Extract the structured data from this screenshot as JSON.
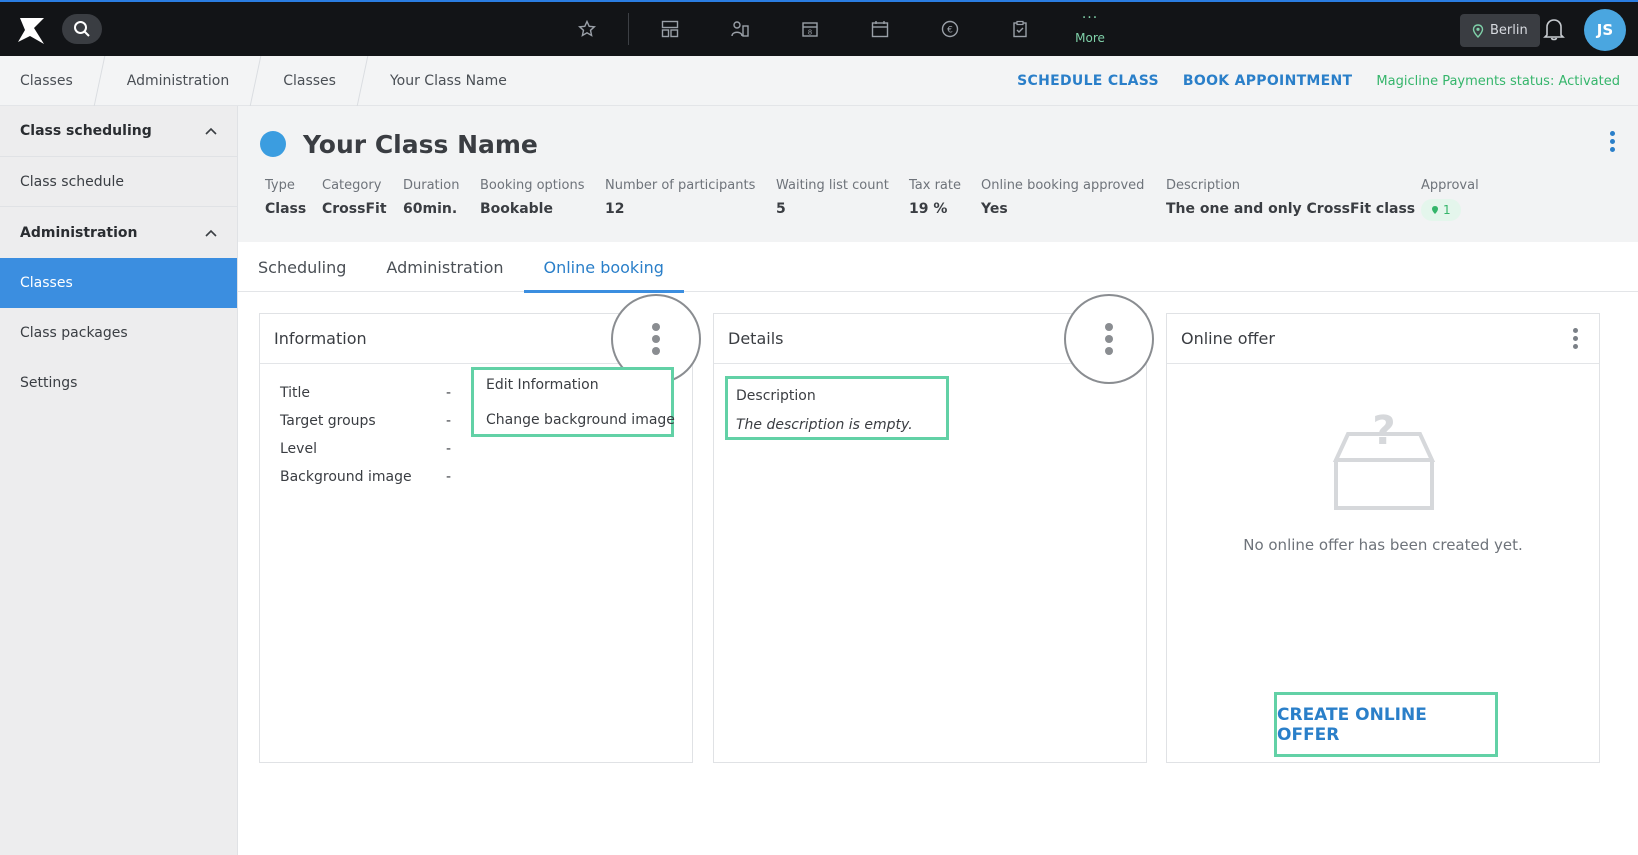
{
  "topbar": {
    "more_label": "More",
    "more_dots": "···",
    "location": "Berlin",
    "avatar_initials": "JS",
    "nav_icons": [
      "star-icon",
      "dashboard-icon",
      "customers-icon",
      "store-icon",
      "calendar-icon",
      "euro-icon",
      "clipboard-icon"
    ]
  },
  "breadcrumb": {
    "items": [
      "Classes",
      "Administration",
      "Classes",
      "Your Class Name"
    ]
  },
  "actions": {
    "schedule_class": "SCHEDULE CLASS",
    "book_appointment": "BOOK APPOINTMENT",
    "payments_status": "Magicline Payments status: Activated"
  },
  "sidebar": {
    "groups": [
      {
        "label": "Class scheduling",
        "items": [
          "Class schedule"
        ]
      },
      {
        "label": "Administration",
        "items": [
          "Classes",
          "Class packages",
          "Settings"
        ]
      }
    ]
  },
  "class": {
    "name": "Your Class Name",
    "meta": [
      {
        "label": "Type",
        "value": "Class"
      },
      {
        "label": "Category",
        "value": "CrossFit"
      },
      {
        "label": "Duration",
        "value": "60min."
      },
      {
        "label": "Booking options",
        "value": "Bookable"
      },
      {
        "label": "Number of participants",
        "value": "12"
      },
      {
        "label": "Waiting list count",
        "value": "5"
      },
      {
        "label": "Tax rate",
        "value": "19 %"
      },
      {
        "label": "Online booking approved",
        "value": "Yes"
      },
      {
        "label": "Description",
        "value": "The one and only CrossFit class"
      }
    ],
    "approval_label": "Approval",
    "approval_count": "1"
  },
  "tabs": [
    "Scheduling",
    "Administration",
    "Online booking"
  ],
  "cards": {
    "information": {
      "title": "Information",
      "rows": [
        {
          "label": "Title",
          "value": "-"
        },
        {
          "label": "Target groups",
          "value": "-"
        },
        {
          "label": "Level",
          "value": "-"
        },
        {
          "label": "Background image",
          "value": "-"
        }
      ],
      "menu": [
        "Edit Information",
        "Change background image"
      ]
    },
    "details": {
      "title": "Details",
      "description_label": "Description",
      "description_empty": "The description is empty."
    },
    "online_offer": {
      "title": "Online offer",
      "empty_text": "No online offer has been created yet.",
      "create_button": "CREATE ONLINE OFFER"
    }
  }
}
